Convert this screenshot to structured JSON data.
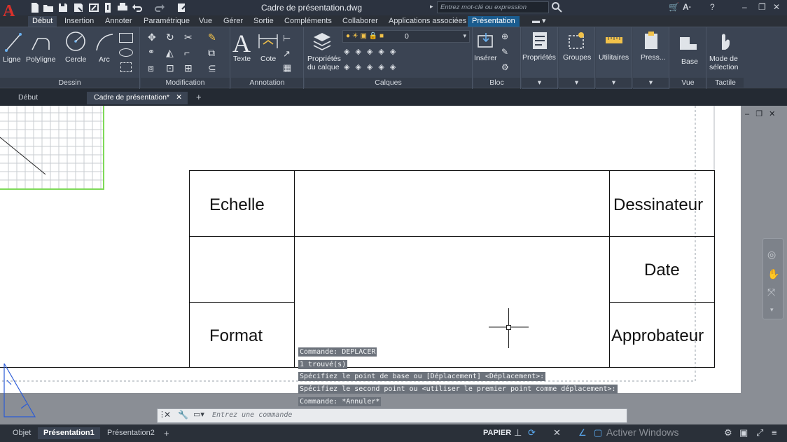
{
  "app": {
    "title": "Cadre de présentation.dwg",
    "logo": "A",
    "search_placeholder": "Entrez mot-clé ou expression"
  },
  "ribbon_tabs": [
    "Début",
    "Insertion",
    "Annoter",
    "Paramétrique",
    "Vue",
    "Gérer",
    "Sortie",
    "Compléments",
    "Collaborer",
    "Applications associées",
    "Présentation"
  ],
  "ribbon": {
    "dessin": {
      "title": "Dessin",
      "tools": [
        "Ligne",
        "Polyligne",
        "Cercle",
        "Arc"
      ]
    },
    "modification": {
      "title": "Modification"
    },
    "annotation": {
      "title": "Annotation",
      "tools": [
        "Texte",
        "Cote"
      ]
    },
    "calques": {
      "title": "Calques",
      "props_line1": "Propriétés",
      "props_line2": "du calque",
      "layer_value": "0"
    },
    "bloc": {
      "title": "Bloc",
      "insert": "Insérer"
    },
    "proprietes": {
      "label": "Propriétés"
    },
    "groupes": {
      "label": "Groupes"
    },
    "utilitaires": {
      "label": "Utilitaires"
    },
    "presse": {
      "label": "Press..."
    },
    "vue": {
      "title": "Vue",
      "base": "Base"
    },
    "tactile": {
      "title": "Tactile",
      "mode_line1": "Mode de",
      "mode_line2": "sélection"
    }
  },
  "file_tabs": [
    "Début",
    "Cadre de présentation*"
  ],
  "title_block": {
    "echelle": "Echelle",
    "format": "Format",
    "dessinateur": "Dessinateur",
    "date": "Date",
    "approbateur": "Approbateur"
  },
  "command_history": [
    "Commande: DEPLACER",
    "1 trouvé(s)",
    "Spécifiez le point de base ou [Déplacement] <Déplacement>:",
    "Spécifiez le second point ou <utiliser le premier point comme déplacement>:",
    "Commande: *Annuler*"
  ],
  "command_input_placeholder": "Entrez une commande",
  "layout_tabs": [
    "Objet",
    "Présentation1",
    "Présentation2"
  ],
  "status": {
    "space": "PAPIER",
    "watermark": "Activer Windows"
  }
}
